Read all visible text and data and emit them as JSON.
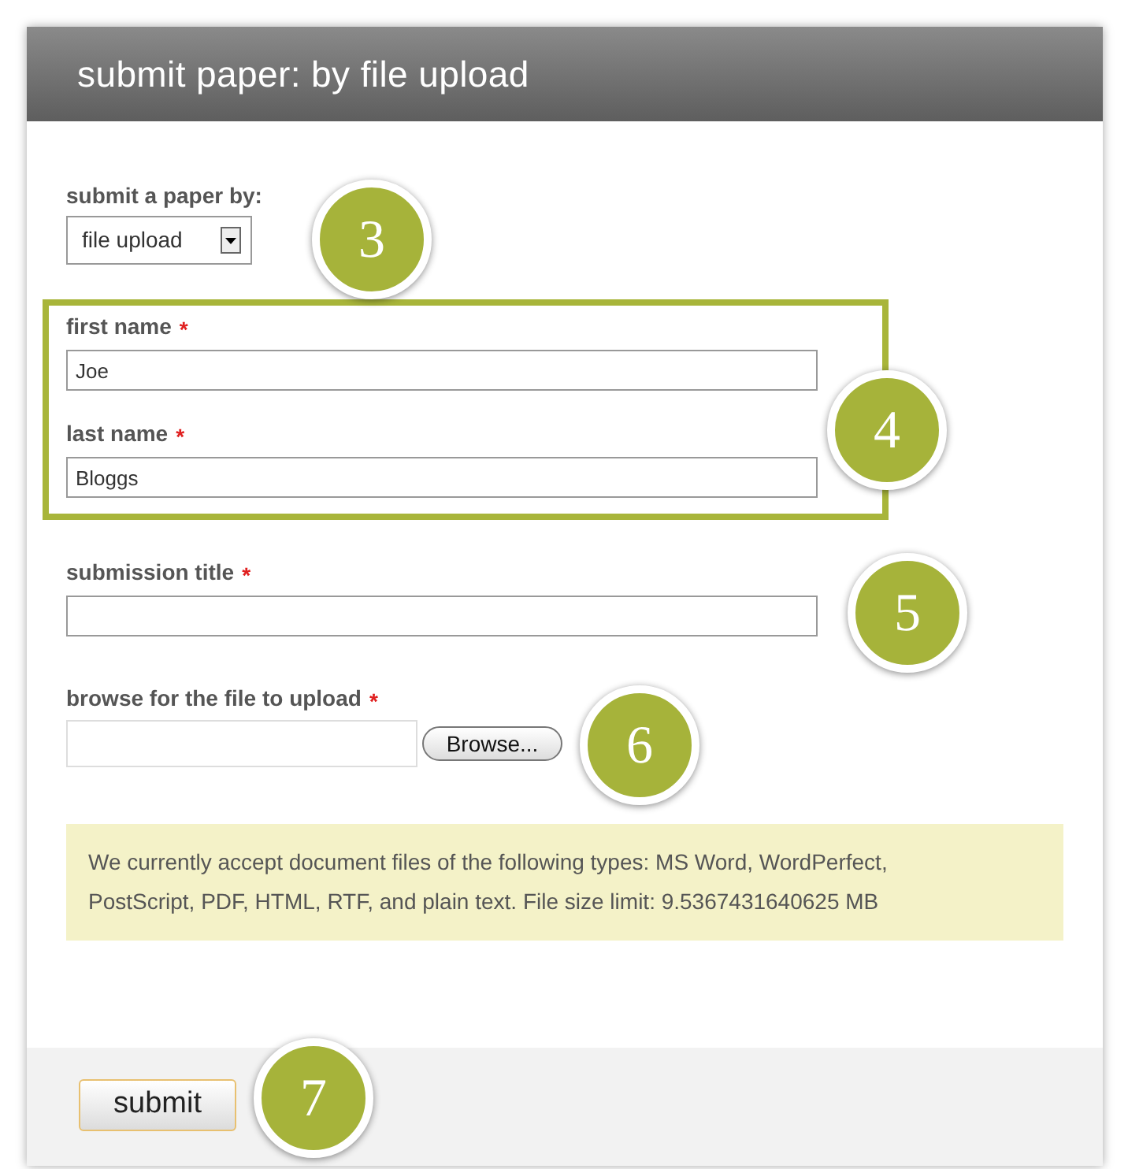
{
  "header": {
    "title": "submit paper: by file upload"
  },
  "required_mark": "*",
  "fields": [
    {
      "kind": "select",
      "label": "submit a paper by:",
      "value": "file upload"
    },
    {
      "kind": "group",
      "children": [
        {
          "kind": "text",
          "label": "first name",
          "required": true,
          "value": "Joe"
        },
        {
          "kind": "text",
          "label": "last name",
          "required": true,
          "value": "Bloggs"
        }
      ]
    },
    {
      "kind": "text",
      "label": "submission title",
      "required": true
    },
    {
      "kind": "file",
      "label": "browse for the file to upload",
      "required": true,
      "button": "Browse..."
    }
  ],
  "note": "We currently accept document files of the following types: MS Word, WordPerfect, PostScript, PDF, HTML, RTF, and plain text. File size limit: 9.5367431640625 MB",
  "submit_button": "submit",
  "callouts": [
    {
      "label": "3"
    },
    {
      "label": "4"
    },
    {
      "label": "5"
    },
    {
      "label": "6"
    },
    {
      "label": "7"
    }
  ]
}
